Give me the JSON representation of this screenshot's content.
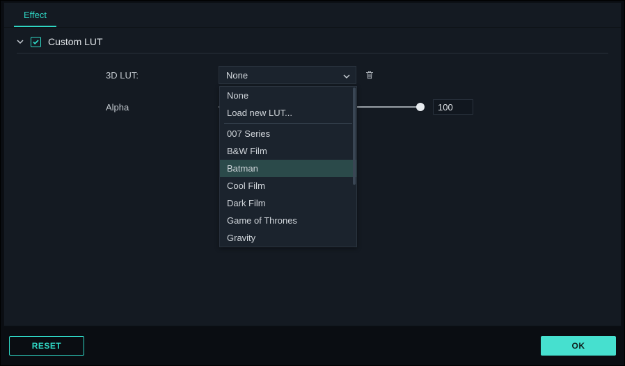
{
  "tabs": {
    "effect": "Effect"
  },
  "section": {
    "title": "Custom LUT",
    "expanded": true,
    "checked": true
  },
  "form": {
    "lut_label": "3D LUT:",
    "lut_selected": "None",
    "alpha_label": "Alpha",
    "alpha_value": "100",
    "alpha_percent": 100
  },
  "dropdown": {
    "top": [
      "None",
      "Load new LUT..."
    ],
    "presets": [
      "007 Series",
      "B&W Film",
      "Batman",
      "Cool Film",
      "Dark Film",
      "Game of Thrones",
      "Gravity"
    ],
    "hover_index": 2
  },
  "footer": {
    "reset": "RESET",
    "ok": "OK"
  },
  "colors": {
    "accent": "#2fd6c4",
    "panel": "#141a22",
    "field": "#1b232d"
  }
}
